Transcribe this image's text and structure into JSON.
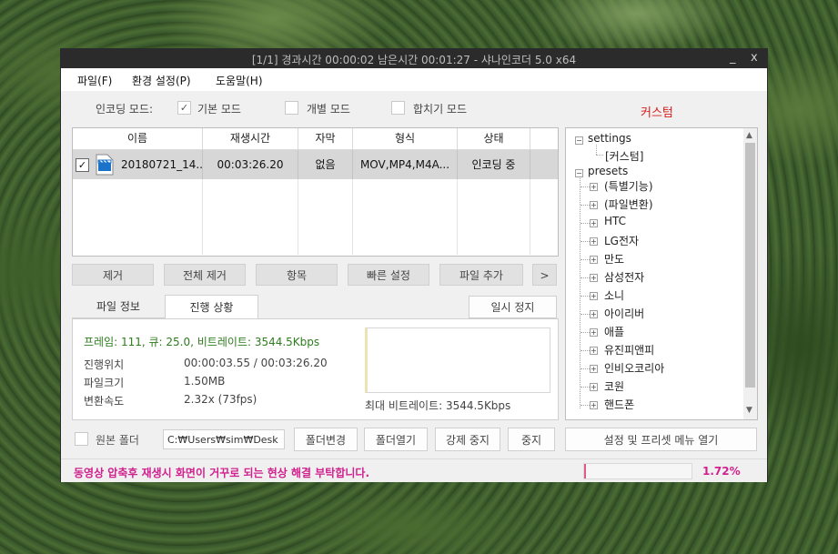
{
  "window": {
    "title": "[1/1] 경과시간 00:00:02  남은시간 00:01:27 - 샤나인코더 5.0 x64",
    "minimize": "_",
    "close": "x"
  },
  "menu": [
    "파일(F)",
    "환경 설정(P)",
    "도움말(H)"
  ],
  "encoding_mode": {
    "label": "인코딩 모드:",
    "basic": "기본 모드",
    "individual": "개별 모드",
    "merge": "합치기 모드",
    "preset_label": "커스텀"
  },
  "file_table": {
    "headers": [
      "이름",
      "재생시간",
      "자막",
      "형식",
      "상태"
    ],
    "rows": [
      {
        "name": "20180721_14...",
        "duration": "00:03:26.20",
        "subtitle": "없음",
        "format": "MOV,MP4,M4A...",
        "status": "인코딩 중",
        "checked": true
      }
    ]
  },
  "action_buttons": [
    "제거",
    "전체 제거",
    "항목",
    "빠른 설정",
    "파일 추가",
    ">"
  ],
  "tabs": {
    "file_info": "파일 정보",
    "progress": "진행 상황",
    "pause": "일시 정지"
  },
  "progress": {
    "stats_line": "프레임: 111, 큐: 25.0, 비트레이트: 3544.5Kbps",
    "position_label": "진행위치",
    "position_value": "00:00:03.55 / 00:03:26.20",
    "filesize_label": "파일크기",
    "filesize_value": "1.50MB",
    "speed_label": "변환속도",
    "speed_value": "2.32x (73fps)",
    "max_bitrate": "최대 비트레이트: 3544.5Kbps"
  },
  "tree": {
    "settings": "settings",
    "custom": "[커스텀]",
    "presets": "presets",
    "items": [
      "(특별기능)",
      "(파일변환)",
      "HTC",
      "LG전자",
      "만도",
      "삼성전자",
      "소니",
      "아이리버",
      "애플",
      "유진피앤피",
      "인비오코리아",
      "코원",
      "핸드폰"
    ]
  },
  "bottom": {
    "source_folder_label": "원본 폴더",
    "path": "C:₩Users₩sim₩Desk",
    "change_folder": "폴더변경",
    "open_folder": "폴더열기",
    "force_stop": "강제 중지",
    "stop": "중지",
    "open_settings": "설정 및 프리셋 메뉴 열기"
  },
  "status": {
    "message": "동영상 압축후 재생시 화면이 거꾸로 되는 현상 해결 부탁합니다.",
    "percent": "1.72%",
    "progress_fraction": 0.0172
  },
  "colors": {
    "accent_red": "#d81b1b",
    "status_magenta": "#d0218f",
    "stats_green": "#2e7d1e"
  }
}
